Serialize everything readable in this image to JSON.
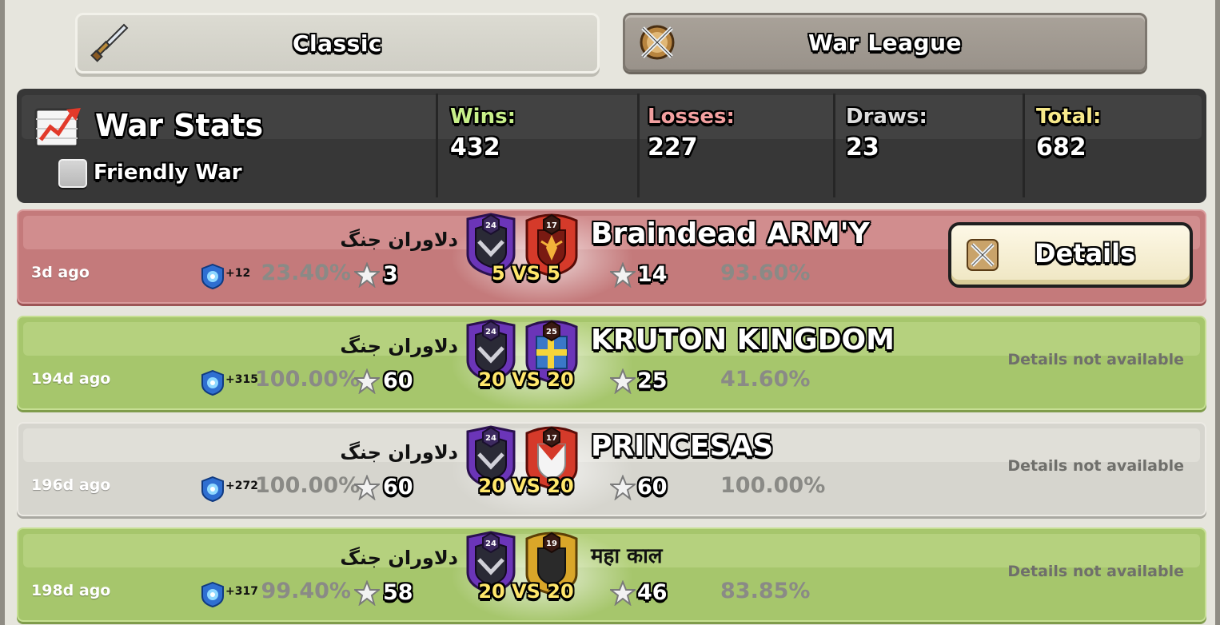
{
  "tabs": [
    {
      "label": "Classic",
      "icon": "sword-icon"
    },
    {
      "label": "War League",
      "icon": "crossed-swords-icon"
    }
  ],
  "stats": {
    "title": "War Stats",
    "friendly_label": "Friendly War",
    "friendly_checked": false,
    "wins_label": "Wins:",
    "wins": "432",
    "losses_label": "Losses:",
    "losses": "227",
    "draws_label": "Draws:",
    "draws": "23",
    "total_label": "Total:",
    "total": "682",
    "colors": {
      "wins": "#c8f08a",
      "losses": "#f2a0a0",
      "draws": "#dcdcdc",
      "total": "#f7e98a"
    }
  },
  "wars": [
    {
      "result": "loss",
      "ago": "3d ago",
      "xp": "+12",
      "our_pct": "23.40%",
      "our_stars": "3",
      "our_name": "دلاوران جنگ",
      "our_level": "24",
      "vs": "5 VS 5",
      "their_name": "Braindead ARM'Y",
      "their_level": "17",
      "their_stars": "14",
      "their_pct": "93.60%",
      "details_label": "Details"
    },
    {
      "result": "win",
      "ago": "194d ago",
      "xp": "+315",
      "our_pct": "100.00%",
      "our_stars": "60",
      "our_name": "دلاوران جنگ",
      "our_level": "24",
      "vs": "20 VS 20",
      "their_name": "KRUTON KINGDOM",
      "their_level": "25",
      "their_stars": "25",
      "their_pct": "41.60%",
      "details_label": "Details not available"
    },
    {
      "result": "draw",
      "ago": "196d ago",
      "xp": "+272",
      "our_pct": "100.00%",
      "our_stars": "60",
      "our_name": "دلاوران جنگ",
      "our_level": "24",
      "vs": "20 VS 20",
      "their_name": "PRINCESAS",
      "their_level": "17",
      "their_stars": "60",
      "their_pct": "100.00%",
      "details_label": "Details not available"
    },
    {
      "result": "win",
      "ago": "198d ago",
      "xp": "+317",
      "our_pct": "99.40%",
      "our_stars": "58",
      "our_name": "دلاوران جنگ",
      "our_level": "24",
      "vs": "20 VS 20",
      "their_name": "महा काल",
      "their_level": "19",
      "their_stars": "46",
      "their_pct": "83.85%",
      "details_label": "Details not available"
    }
  ]
}
